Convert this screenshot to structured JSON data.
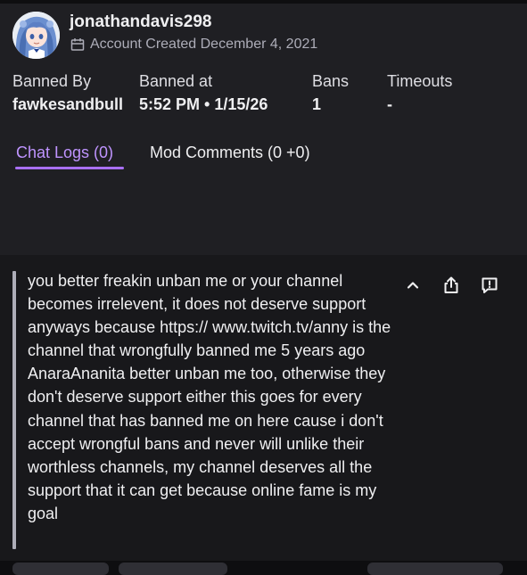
{
  "user": {
    "username": "jonathandavis298",
    "account_created": "Account Created December 4, 2021",
    "avatar_icon": "anime-avatar-icon",
    "calendar_icon": "calendar-icon"
  },
  "stats": [
    {
      "label": "Banned By",
      "value": "fawkesandbull"
    },
    {
      "label": "Banned at",
      "value": "5:52 PM • 1/15/26"
    },
    {
      "label": "Bans",
      "value": "1"
    },
    {
      "label": "Timeouts",
      "value": "-"
    }
  ],
  "tabs": [
    {
      "label": "Chat Logs (0)",
      "active": true
    },
    {
      "label": "Mod Comments (0 +0)",
      "active": false
    }
  ],
  "message": {
    "text": "you better freakin unban me or your channel becomes irrelevent, it does not deserve support anyways because https:// www.twitch.tv/anny is the channel that wrongfully banned me 5 years ago AnaraAnanita better unban me too, otherwise they don't deserve support either this goes for every channel that has banned me on here cause i don't accept wrongful bans and never will unlike their worthless channels, my channel deserves all the support that it can get because online fame is my goal",
    "actions": [
      "chevron-up-icon",
      "share-icon",
      "report-icon"
    ]
  },
  "colors": {
    "accent": "#bf94ff",
    "accent_underline": "#a970ff",
    "card_bg": "#1f1f23",
    "panel_bg": "#18181b",
    "muted_text": "#adadb8"
  }
}
